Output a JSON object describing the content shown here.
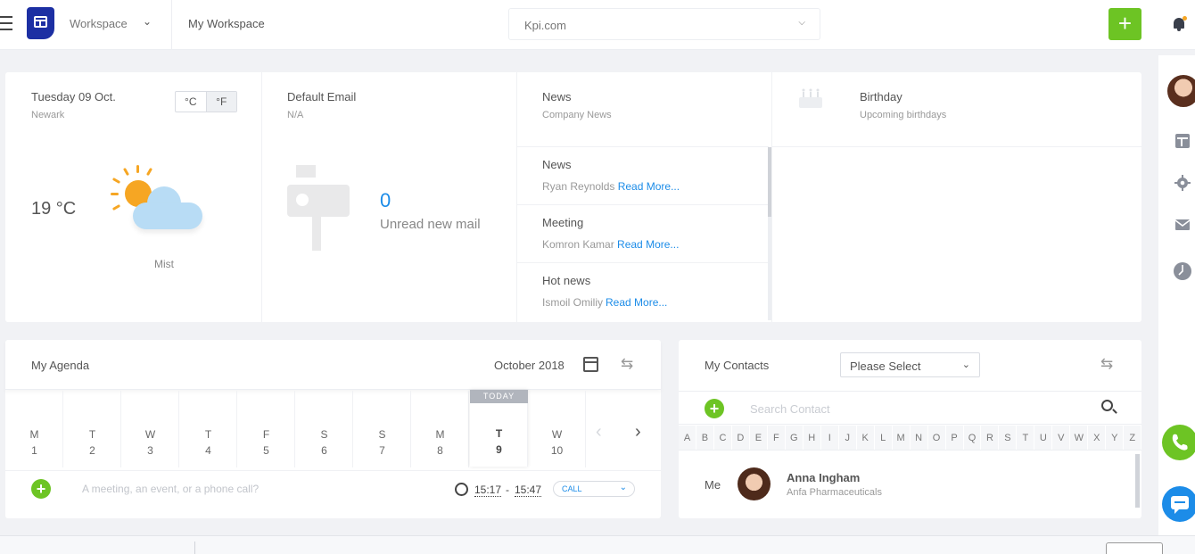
{
  "header": {
    "workspace_label": "Workspace",
    "breadcrumb": "My Workspace",
    "domain_value": "Kpi.com",
    "add_label": "+"
  },
  "weather": {
    "date": "Tuesday 09 Oct.",
    "location": "Newark",
    "unit_c": "°C",
    "unit_f": "°F",
    "temperature": "19 °C",
    "condition": "Mist"
  },
  "email": {
    "title": "Default Email",
    "subtitle": "N/A",
    "count": "0",
    "count_label": "Unread new mail"
  },
  "news": {
    "title": "News",
    "subtitle": "Company News",
    "items": [
      {
        "title": "News",
        "author": "Ryan Reynolds",
        "link": "Read More..."
      },
      {
        "title": "Meeting",
        "author": "Komron Kamar",
        "link": "Read More..."
      },
      {
        "title": "Hot news",
        "author": "Ismoil Omiliy",
        "link": "Read More..."
      }
    ]
  },
  "birthday": {
    "title": "Birthday",
    "subtitle": "Upcoming birthdays"
  },
  "agenda": {
    "title": "My Agenda",
    "month": "October 2018",
    "today_badge": "TODAY",
    "days": [
      {
        "name": "M",
        "num": "1"
      },
      {
        "name": "T",
        "num": "2"
      },
      {
        "name": "W",
        "num": "3"
      },
      {
        "name": "T",
        "num": "4"
      },
      {
        "name": "F",
        "num": "5"
      },
      {
        "name": "S",
        "num": "6"
      },
      {
        "name": "S",
        "num": "7"
      },
      {
        "name": "M",
        "num": "8"
      },
      {
        "name": "T",
        "num": "9"
      },
      {
        "name": "W",
        "num": "10"
      }
    ],
    "input_placeholder": "A meeting, an event, or a phone call?",
    "start_time": "15:17",
    "time_sep": "-",
    "end_time": "15:47",
    "call_type": "CALL"
  },
  "contacts": {
    "title": "My Contacts",
    "select_value": "Please Select",
    "search_placeholder": "Search Contact",
    "letters": [
      "A",
      "B",
      "C",
      "D",
      "E",
      "F",
      "G",
      "H",
      "I",
      "J",
      "K",
      "L",
      "M",
      "N",
      "O",
      "P",
      "Q",
      "R",
      "S",
      "T",
      "U",
      "V",
      "W",
      "X",
      "Y",
      "Z"
    ],
    "row_label": "Me",
    "contact_name": "Anna Ingham",
    "contact_company": "Anfa Pharmaceuticals"
  },
  "colors": {
    "accent_green": "#6dc424",
    "accent_blue": "#1c8ce8",
    "brand_navy": "#1c2fa3"
  }
}
